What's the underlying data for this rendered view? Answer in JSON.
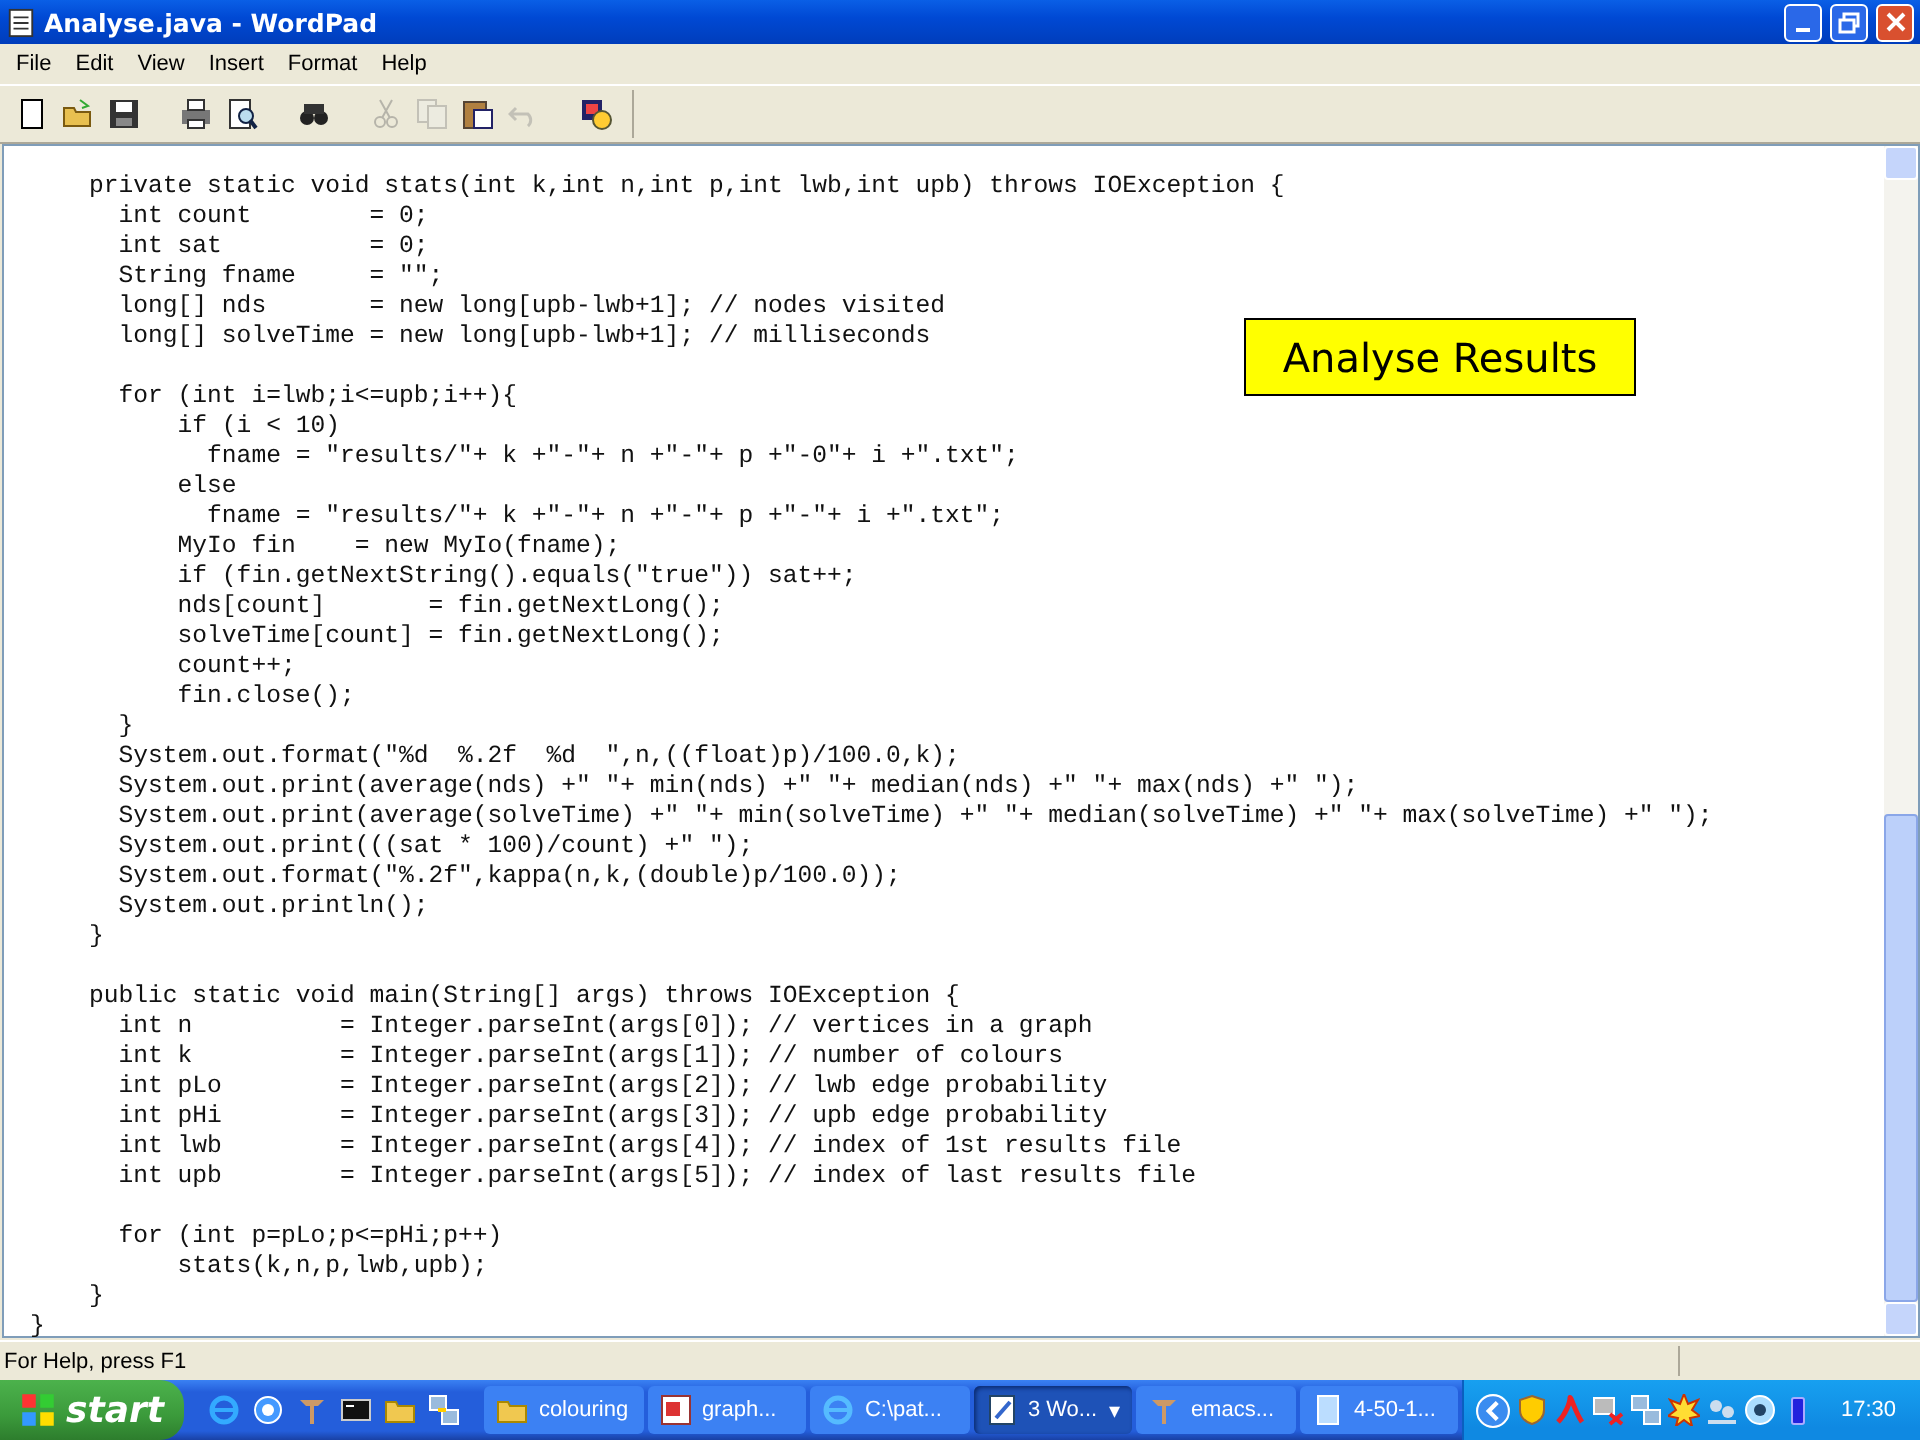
{
  "window": {
    "title": "Analyse.java - WordPad"
  },
  "menu": [
    "File",
    "Edit",
    "View",
    "Insert",
    "Format",
    "Help"
  ],
  "toolbar": [
    {
      "disabled": false
    },
    {
      "disabled": false
    },
    {
      "disabled": false
    },
    {
      "disabled": false
    },
    {
      "disabled": false
    },
    {
      "disabled": false
    },
    {
      "disabled": true
    },
    {
      "disabled": true
    },
    {
      "disabled": false
    },
    {
      "disabled": true
    },
    {
      "disabled": false
    }
  ],
  "document": {
    "blocks": [
      {
        "lines": [
          "    private static void stats(int k,int n,int p,int lwb,int upb) throws IOException {",
          "      int count        = 0;",
          "      int sat          = 0;",
          "      String fname     = \"\";",
          "      long[] nds       = new long[upb-lwb+1]; // nodes visited",
          "      long[] solveTime = new long[upb-lwb+1]; // milliseconds"
        ]
      },
      {
        "lines": [
          "      for (int i=lwb;i<=upb;i++){",
          "          if (i < 10)",
          "            fname = \"results/\"+ k +\"-\"+ n +\"-\"+ p +\"-0\"+ i +\".txt\";",
          "          else",
          "            fname = \"results/\"+ k +\"-\"+ n +\"-\"+ p +\"-\"+ i +\".txt\";",
          "          MyIo fin    = new MyIo(fname);",
          "          if (fin.getNextString().equals(\"true\")) sat++;",
          "          nds[count]       = fin.getNextLong();",
          "          solveTime[count] = fin.getNextLong();",
          "          count++;",
          "          fin.close();",
          "      }",
          "      System.out.format(\"%d  %.2f  %d  \",n,((float)p)/100.0,k);",
          "      System.out.print(average(nds) +\" \"+ min(nds) +\" \"+ median(nds) +\" \"+ max(nds) +\" \");",
          "      System.out.print(average(solveTime) +\" \"+ min(solveTime) +\" \"+ median(solveTime) +\" \"+ max(solveTime) +\" \");",
          "      System.out.print(((sat * 100)/count) +\" \");",
          "      System.out.format(\"%.2f\",kappa(n,k,(double)p/100.0));",
          "      System.out.println();",
          "    }"
        ]
      },
      {
        "lines": [
          "    public static void main(String[] args) throws IOException {",
          "      int n          = Integer.parseInt(args[0]); // vertices in a graph",
          "      int k          = Integer.parseInt(args[1]); // number of colours",
          "      int pLo        = Integer.parseInt(args[2]); // lwb edge probability",
          "      int pHi        = Integer.parseInt(args[3]); // upb edge probability",
          "      int lwb        = Integer.parseInt(args[4]); // index of 1st results file",
          "      int upb        = Integer.parseInt(args[5]); // index of last results file"
        ]
      },
      {
        "lines": [
          "      for (int p=pLo;p<=pHi;p++)",
          "          stats(k,n,p,lwb,upb);",
          "    }",
          "}"
        ]
      }
    ]
  },
  "callout": {
    "text": "Analyse Results"
  },
  "status_bar": {
    "text": "For Help, press F1"
  },
  "taskbar": {
    "start": "start",
    "tasks": [
      {
        "label": "colouring",
        "selected": false
      },
      {
        "label": "graph...",
        "selected": false
      },
      {
        "label": "C:\\pat...",
        "selected": false
      },
      {
        "label": "3 Wo...",
        "selected": true,
        "caret": "▾"
      },
      {
        "label": "emacs...",
        "selected": false
      },
      {
        "label": "4-50-1...",
        "selected": false
      }
    ],
    "clock": "17:30"
  }
}
